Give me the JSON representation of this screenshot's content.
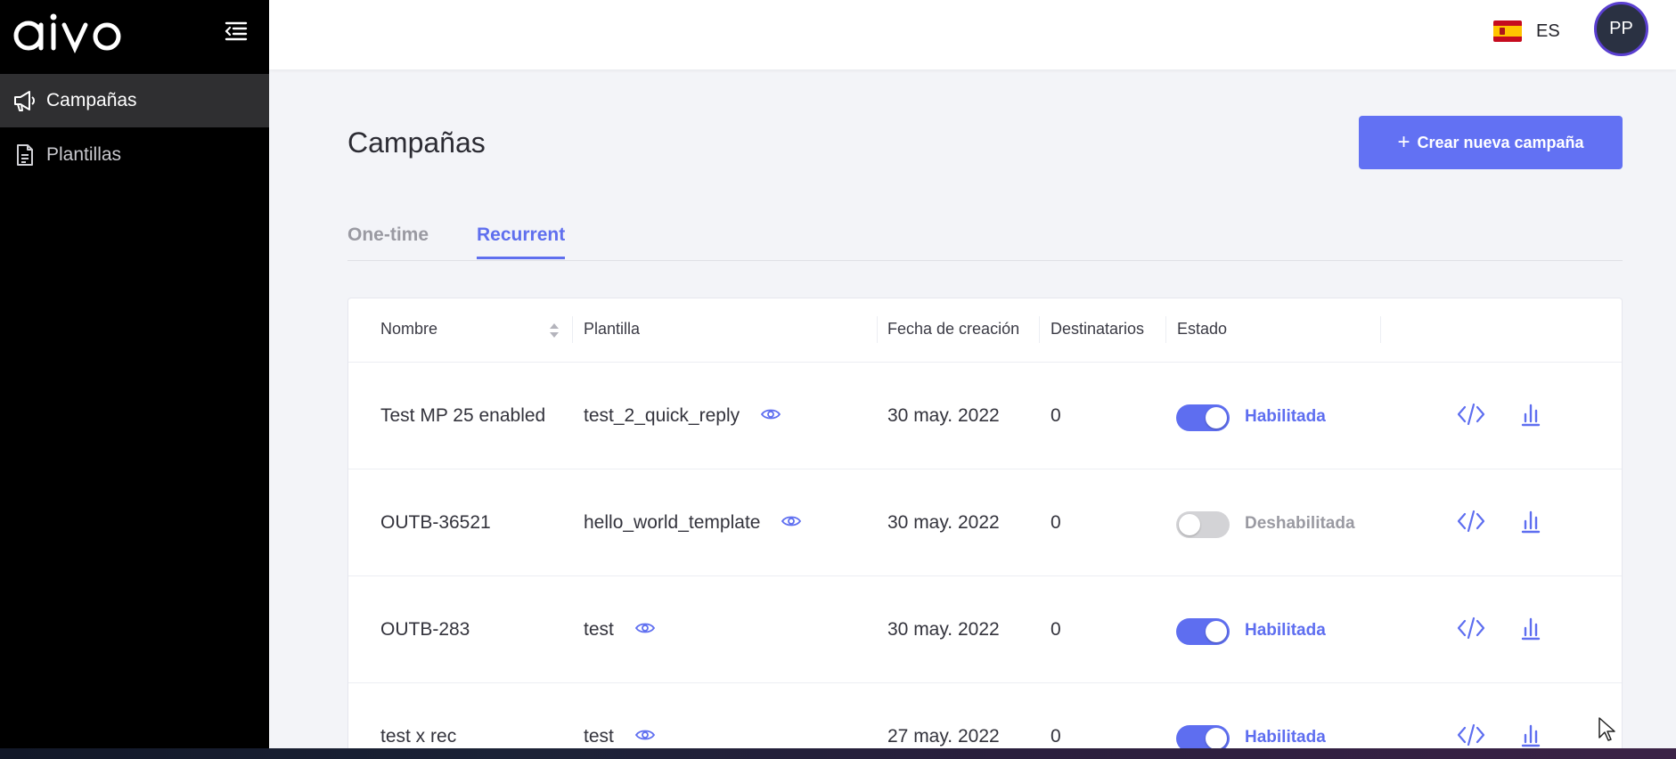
{
  "sidebar": {
    "logo_text": "aivo",
    "items": [
      {
        "label": "Campañas",
        "icon": "megaphone-icon",
        "active": true
      },
      {
        "label": "Plantillas",
        "icon": "document-icon",
        "active": false
      }
    ]
  },
  "header": {
    "language": "ES",
    "flag": "spain-flag-icon",
    "avatar_initials": "PP"
  },
  "main": {
    "title": "Campañas",
    "create_button": {
      "plus": "+",
      "label": "Crear nueva campaña"
    },
    "tabs": [
      {
        "label": "One-time",
        "active": false
      },
      {
        "label": "Recurrent",
        "active": true
      }
    ],
    "table": {
      "columns": [
        "Nombre",
        "Plantilla",
        "Fecha de creación",
        "Destinatarios",
        "Estado"
      ],
      "rows": [
        {
          "nombre": "Test MP 25 enabled",
          "plantilla": "test_2_quick_reply",
          "fecha": "30 may. 2022",
          "destinatarios": "0",
          "estado": "Habilitada",
          "enabled": true
        },
        {
          "nombre": "OUTB-36521",
          "plantilla": "hello_world_template",
          "fecha": "30 may. 2022",
          "destinatarios": "0",
          "estado": "Deshabilitada",
          "enabled": false
        },
        {
          "nombre": "OUTB-283",
          "plantilla": "test",
          "fecha": "30 may. 2022",
          "destinatarios": "0",
          "estado": "Habilitada",
          "enabled": true
        },
        {
          "nombre": "test x rec",
          "plantilla": "test",
          "fecha": "27 may. 2022",
          "destinatarios": "0",
          "estado": "Habilitada",
          "enabled": true
        }
      ]
    }
  },
  "colors": {
    "accent": "#6271f3",
    "sidebar_bg": "#000000",
    "sidebar_active": "#2f2f31",
    "page_bg": "#f3f4f8"
  }
}
